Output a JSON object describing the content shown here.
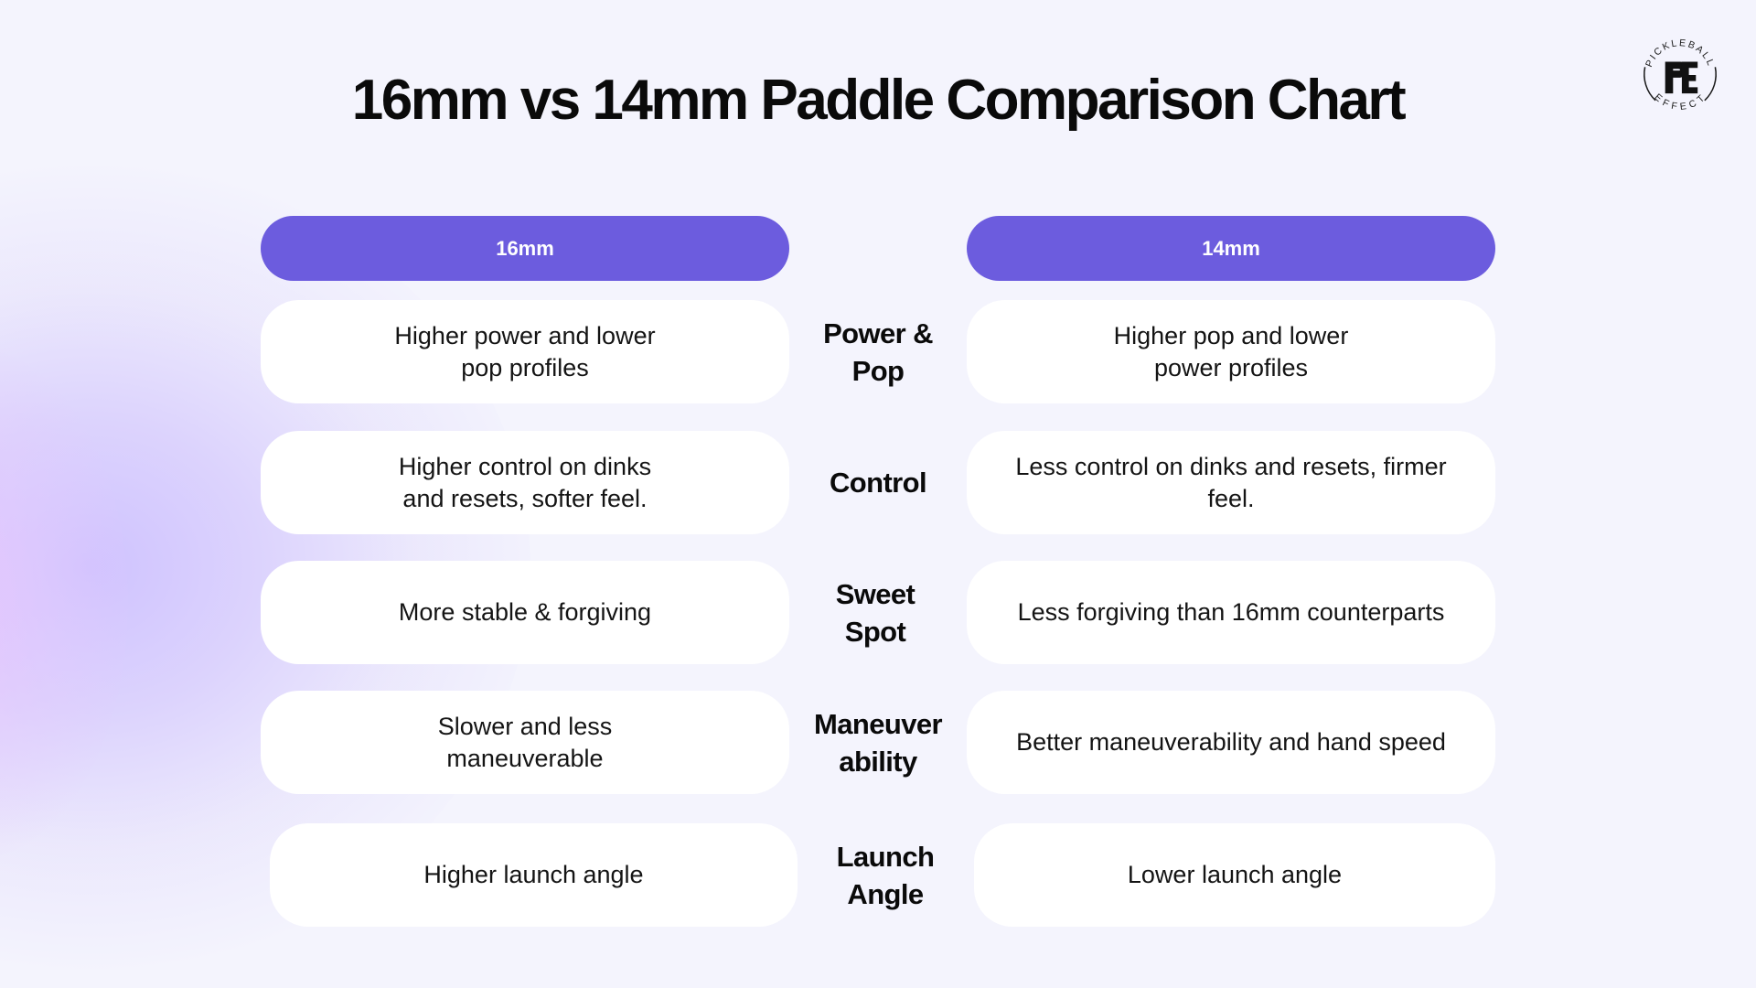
{
  "title": "16mm vs 14mm Paddle Comparison Chart",
  "logo": {
    "top_text": "PICKLEBALL",
    "bottom_text": "EFFECT",
    "monogram": "PE"
  },
  "columns": {
    "left_header": "16mm",
    "right_header": "14mm",
    "accent_color": "#6C5CDE"
  },
  "rows": [
    {
      "label_lines": [
        "Power &",
        "Pop"
      ],
      "left_lines": [
        "Higher power and lower",
        "pop profiles"
      ],
      "right_lines": [
        "Higher pop and lower",
        "power profiles"
      ]
    },
    {
      "label_lines": [
        "Control"
      ],
      "left_lines": [
        "Higher control on dinks",
        "and resets, softer feel."
      ],
      "right_lines": [
        "Less control on dinks and resets, firmer",
        "feel."
      ]
    },
    {
      "label_lines": [
        "Sweet",
        "Spot"
      ],
      "left_lines": [
        "More stable & forgiving"
      ],
      "right_lines": [
        "Less forgiving than 16mm counterparts"
      ]
    },
    {
      "label_lines": [
        "Maneuver",
        "ability"
      ],
      "left_lines": [
        "Slower and less",
        "maneuverable"
      ],
      "right_lines": [
        "Better maneuverability and hand speed"
      ]
    },
    {
      "label_lines": [
        "Launch",
        "Angle"
      ],
      "left_lines": [
        "Higher launch angle"
      ],
      "right_lines": [
        "Lower launch angle"
      ]
    }
  ]
}
